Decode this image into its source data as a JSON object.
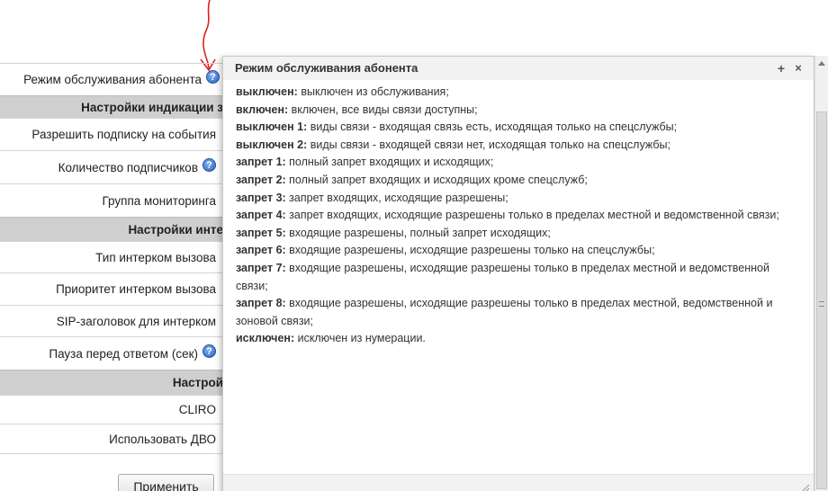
{
  "form": {
    "rows": [
      {
        "label": "Режим обслуживания абонента",
        "help": true
      },
      {
        "label": "Настройки индикации з",
        "section": true
      },
      {
        "label": "Разрешить подписку на события",
        "help": false
      },
      {
        "label": "Количество подписчиков",
        "help": true
      },
      {
        "label": "Группа мониторинга",
        "help": false
      },
      {
        "label": "Настройки инте",
        "section": true
      },
      {
        "label": "Тип интерком вызова",
        "help": false
      },
      {
        "label": "Приоритет интерком вызова",
        "help": false
      },
      {
        "label": "SIP-заголовок для интерком",
        "help": false
      },
      {
        "label": "Пауза перед ответом (сек)",
        "help": true
      },
      {
        "label": "Настрой",
        "section": true
      },
      {
        "label": "CLIRO",
        "help": false
      },
      {
        "label": "Использовать ДВО",
        "help": false
      }
    ],
    "apply_label": "Применить",
    "help_glyph": "?"
  },
  "popup": {
    "title": "Режим обслуживания абонента",
    "max_glyph": "+",
    "close_glyph": "×",
    "entries": [
      {
        "term": "выключен:",
        "text": " выключен из обслуживания;"
      },
      {
        "term": "включен:",
        "text": " включен, все виды связи доступны;"
      },
      {
        "term": "выключен 1:",
        "text": " виды связи - входящая связь есть, исходящая только на спецслужбы;"
      },
      {
        "term": "выключен 2:",
        "text": " виды связи - входящей связи нет, исходящая только на спецслужбы;"
      },
      {
        "term": "запрет 1:",
        "text": " полный запрет входящих и исходящих;"
      },
      {
        "term": "запрет 2:",
        "text": " полный запрет входящих и исходящих кроме спецслужб;"
      },
      {
        "term": "запрет 3:",
        "text": " запрет входящих, исходящие разрешены;"
      },
      {
        "term": "запрет 4:",
        "text": " запрет входящих, исходящие разрешены только в пределах местной и ведомственной связи;"
      },
      {
        "term": "запрет 5:",
        "text": " входящие разрешены, полный запрет исходящих;"
      },
      {
        "term": "запрет 6:",
        "text": " входящие разрешены, исходящие разрешены только на спецслужбы;"
      },
      {
        "term": "запрет 7:",
        "text": " входящие разрешены, исходящие разрешены только в пределах местной и ведомственной связи;"
      },
      {
        "term": "запрет 8:",
        "text": " входящие разрешены, исходящие разрешены только в пределах местной, ведомственной и зоновой связи;"
      },
      {
        "term": "исключен:",
        "text": " исключен из нумерации."
      }
    ]
  },
  "colors": {
    "section_bg": "#cfcfcf",
    "help_icon": "#2c63c4",
    "arrow": "#e02020"
  }
}
